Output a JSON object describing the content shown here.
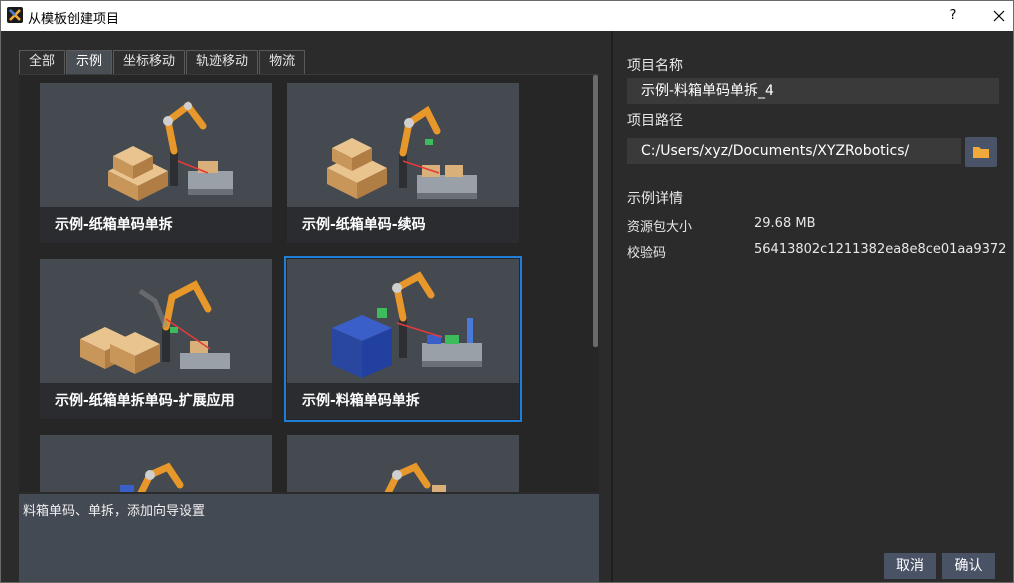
{
  "window": {
    "title": "从模板创建项目",
    "help": "?"
  },
  "tabs": [
    "全部",
    "示例",
    "坐标移动",
    "轨迹移动",
    "物流"
  ],
  "cards": [
    {
      "label": "示例-纸箱单码单拆"
    },
    {
      "label": "示例-纸箱单码-续码"
    },
    {
      "label": "示例-纸箱单拆单码-扩展应用"
    },
    {
      "label": "示例-料箱单码单拆"
    }
  ],
  "description": "料箱单码、单拆，添加向导设置",
  "right": {
    "name_label": "项目名称",
    "name_value": "示例-料箱单码单拆_4",
    "path_label": "项目路径",
    "path_value": "C:/Users/xyz/Documents/XYZRobotics/",
    "details_label": "示例详情",
    "size_label": "资源包大小",
    "size_value": "29.68 MB",
    "checksum_label": "校验码",
    "checksum_value": "56413802c1211382ea8e8ce01aa9372"
  },
  "buttons": {
    "cancel": "取消",
    "confirm": "确认"
  },
  "colors": {
    "accent": "#1f7fd8",
    "robot": "#e8982a",
    "box": "#d9b07a",
    "folder": "#f2a93b"
  }
}
